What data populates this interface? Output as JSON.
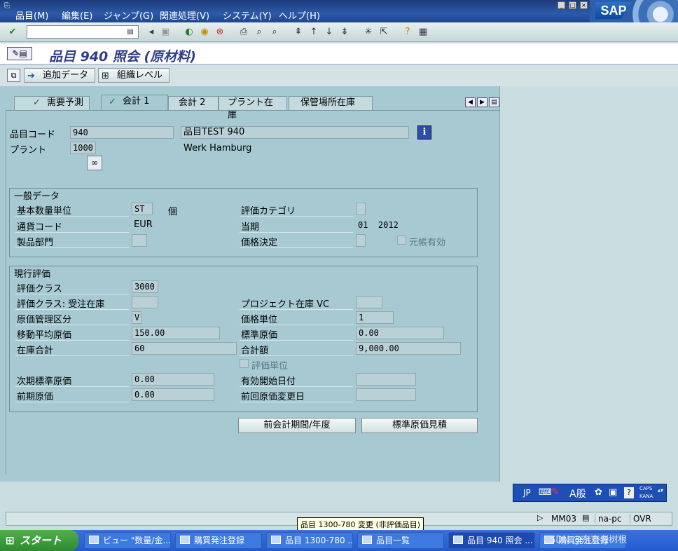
{
  "menubar": {
    "items": [
      "品目(M)",
      "編集(E)",
      "ジャンプ(G)",
      "関連処理(V)",
      "システム(Y)",
      "ヘルプ(H)"
    ],
    "logo": "SAP"
  },
  "toolbar": {
    "command_value": ""
  },
  "title": {
    "text": "品目 940 照会 (原材料)"
  },
  "appbar": {
    "additional_data": "追加データ",
    "org_levels": "組織レベル"
  },
  "tabs": [
    {
      "label": "需要予測",
      "active": false
    },
    {
      "label": "会計 1",
      "active": true
    },
    {
      "label": "会計 2",
      "active": false
    },
    {
      "label": "プラント在庫",
      "active": false
    },
    {
      "label": "保管場所在庫",
      "active": false
    }
  ],
  "header": {
    "material_label": "品目コード",
    "material_value": "940",
    "material_desc": "品目TEST 940",
    "plant_label": "プラント",
    "plant_value": "1000",
    "plant_desc": "Werk Hamburg"
  },
  "general": {
    "title": "一般データ",
    "base_unit_label": "基本数量単位",
    "base_unit_value": "ST",
    "base_unit_text": "個",
    "valuation_cat_label": "評価カテゴリ",
    "valuation_cat_value": "",
    "currency_label": "通貨コード",
    "currency_value": "EUR",
    "period_label": "当期",
    "period_value": "01  2012",
    "division_label": "製品部門",
    "division_value": "",
    "price_det_label": "価格決定",
    "price_det_value": "",
    "ledger_active_label": "元帳有効"
  },
  "valuation": {
    "title": "現行評価",
    "class_label": "評価クラス",
    "class_value": "3000",
    "class_so_label": "評価クラス: 受注在庫",
    "class_so_value": "",
    "proj_stock_label": "プロジェクト在庫 VC",
    "proj_stock_value": "",
    "price_control_label": "原価管理区分",
    "price_control_value": "V",
    "price_unit_label": "価格単位",
    "price_unit_value": "1",
    "map_label": "移動平均原価",
    "map_value": "150.00",
    "std_price_label": "標準原価",
    "std_price_value": "0.00",
    "total_stock_label": "在庫合計",
    "total_stock_value": "60",
    "total_value_label": "合計額",
    "total_value_value": "9,000.00",
    "valuated_unit_label": "評価単位",
    "future_price_label": "次期標準原価",
    "future_price_value": "0.00",
    "valid_from_label": "有効開始日付",
    "valid_from_value": "",
    "prev_price_label": "前期原価",
    "prev_price_value": "0.00",
    "last_change_label": "前回原価変更日",
    "last_change_value": ""
  },
  "buttons": {
    "prev_period": "前会計期間/年度",
    "std_cost_est": "標準原価見積"
  },
  "status": {
    "tcode": "MM03",
    "server": "na-pc",
    "mode": "OVR"
  },
  "tooltip": "品目 1300-780 変更 (非評価品目)",
  "ime": {
    "lang": "JP",
    "mode": "A般",
    "caps": "CAPS",
    "kana": "KANA"
  },
  "taskbar": {
    "start": "スタート",
    "tasks": [
      "ビュー \"数量/金...",
      "購買発注登録",
      "品目 1300-780 ...",
      "品目一覧",
      "品目 940 照会 ...",
      "購買発注登録"
    ],
    "tray": "CSDN @东京老树根"
  }
}
